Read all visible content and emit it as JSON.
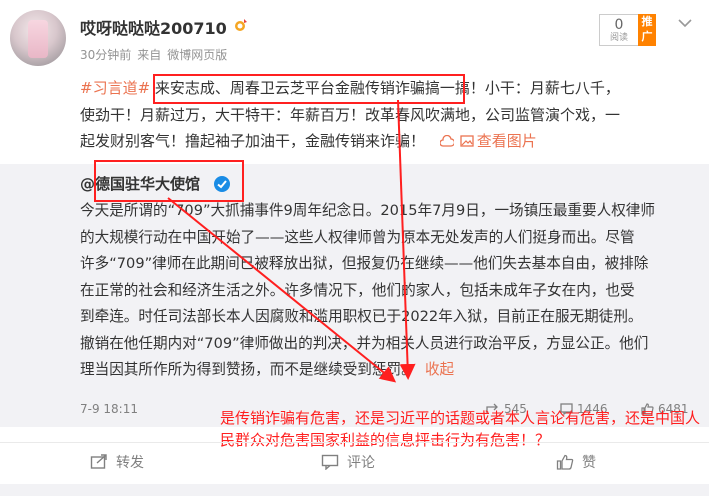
{
  "user": {
    "name": "哎呀哒哒哒200710",
    "time": "30分钟前",
    "source_prefix": "来自",
    "source": "微博网页版"
  },
  "read_box": {
    "count": "0",
    "label": "阅读"
  },
  "promote": "推广",
  "post": {
    "hashtag": "#习言道#",
    "line1": " 来安志成、周春卫云芝平台金融传销诈骗搞一搞！小干：月薪七八千，",
    "line2": "使劲干！月薪过万，大干特干：年薪百万！改革春风吹满地，公司监管演个戏，一",
    "line3": "起发财别客气！撸起袖子加油干，金融传销来诈骗！",
    "view_image": "查看图片"
  },
  "repost": {
    "author": "@德国驻华大使馆",
    "lines": [
      "今天是所谓的“709”大抓捕事件9周年纪念日。2015年7月9日，一场镇压最重要人权律师",
      "的大规模行动在中国开始了——这些人权律师曾为原本无处发声的人们挺身而出。尽管",
      "许多“709”律师在此期间已被释放出狱，但报复仍在继续——他们失去基本自由，被排除",
      "在正常的社会和经济生活之外。许多情况下，他们的家人，包括未成年子女在内，也受",
      "到牵连。时任司法部长本人因腐败和滥用职权已于2022年入狱，目前正在服无期徒刑。",
      "撤销在他任期内对“709”律师做出的判决，并为相关人员进行政治平反，方显公正。他们",
      "理当因其所作所为得到赞扬，而不是继续受到惩罚。"
    ],
    "collapse": "收起",
    "time": "7-9 18:11",
    "stats": {
      "reposts": "545",
      "comments": "1446",
      "likes": "6481"
    }
  },
  "annotation": "是传销诈骗有危害，还是习近平的话题或者本人言论有危害，还是中国人民群众对危害国家利益的信息抨击行为有危害！？",
  "footer": {
    "repost": "转发",
    "comment": "评论",
    "like": "赞"
  },
  "colors": {
    "accent": "#eb7350",
    "annotation_red": "#ff1f1f",
    "repost_bg": "#f2f2f5",
    "promo": "#ff8200"
  }
}
